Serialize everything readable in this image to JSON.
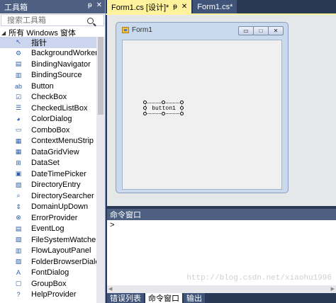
{
  "toolbox": {
    "title": "工具箱",
    "pin_glyph": "ᵽ",
    "close_glyph": "✕",
    "search_placeholder": "搜索工具箱",
    "category": "所有 Windows 窗体",
    "items": [
      {
        "label": "指针",
        "icon": "pointer-icon",
        "glyph": "↖"
      },
      {
        "label": "BackgroundWorker",
        "icon": "backgroundworker-icon",
        "glyph": "⚙"
      },
      {
        "label": "BindingNavigator",
        "icon": "bindingnavigator-icon",
        "glyph": "▤"
      },
      {
        "label": "BindingSource",
        "icon": "bindingsource-icon",
        "glyph": "▥"
      },
      {
        "label": "Button",
        "icon": "button-icon",
        "glyph": "ab"
      },
      {
        "label": "CheckBox",
        "icon": "checkbox-icon",
        "glyph": "☑"
      },
      {
        "label": "CheckedListBox",
        "icon": "checkedlistbox-icon",
        "glyph": "☰"
      },
      {
        "label": "ColorDialog",
        "icon": "colordialog-icon",
        "glyph": "◕"
      },
      {
        "label": "ComboBox",
        "icon": "combobox-icon",
        "glyph": "▭"
      },
      {
        "label": "ContextMenuStrip",
        "icon": "contextmenustrip-icon",
        "glyph": "▦"
      },
      {
        "label": "DataGridView",
        "icon": "datagridview-icon",
        "glyph": "▦"
      },
      {
        "label": "DataSet",
        "icon": "dataset-icon",
        "glyph": "⊞"
      },
      {
        "label": "DateTimePicker",
        "icon": "datetimepicker-icon",
        "glyph": "▣"
      },
      {
        "label": "DirectoryEntry",
        "icon": "directoryentry-icon",
        "glyph": "▧"
      },
      {
        "label": "DirectorySearcher",
        "icon": "directorysearcher-icon",
        "glyph": "⌕"
      },
      {
        "label": "DomainUpDown",
        "icon": "domainupdown-icon",
        "glyph": "⇕"
      },
      {
        "label": "ErrorProvider",
        "icon": "errorprovider-icon",
        "glyph": "⊗"
      },
      {
        "label": "EventLog",
        "icon": "eventlog-icon",
        "glyph": "▤"
      },
      {
        "label": "FileSystemWatcher",
        "icon": "filesystemwatcher-icon",
        "glyph": "▧"
      },
      {
        "label": "FlowLayoutPanel",
        "icon": "flowlayoutpanel-icon",
        "glyph": "▥"
      },
      {
        "label": "FolderBrowserDialog",
        "icon": "folderbrowserdialog-icon",
        "glyph": "▨"
      },
      {
        "label": "FontDialog",
        "icon": "fontdialog-icon",
        "glyph": "A"
      },
      {
        "label": "GroupBox",
        "icon": "groupbox-icon",
        "glyph": "▢"
      },
      {
        "label": "HelpProvider",
        "icon": "helpprovider-icon",
        "glyph": "?"
      }
    ]
  },
  "tabs": [
    {
      "label": "Form1.cs [设计]*",
      "active": true,
      "pin": "ᵽ",
      "close": "✕"
    },
    {
      "label": "Form1.cs*",
      "active": false
    }
  ],
  "designer": {
    "form_title": "Form1",
    "minimize_glyph": "▭",
    "maximize_glyph": "□",
    "close_glyph": "✕",
    "button_text": "button1"
  },
  "command_window": {
    "title": "命令窗口",
    "prompt": ">"
  },
  "bottom_tabs": [
    {
      "label": "错误列表",
      "active": false
    },
    {
      "label": "命令窗口",
      "active": true
    },
    {
      "label": "输出",
      "active": false
    }
  ],
  "watermark": "http://blog.csdn.net/xiaohu1996",
  "colors": {
    "chrome_dark": "#293955",
    "panel_header": "#4d6082",
    "active_tab": "#fff29d",
    "selection": "#cbd6ee"
  }
}
